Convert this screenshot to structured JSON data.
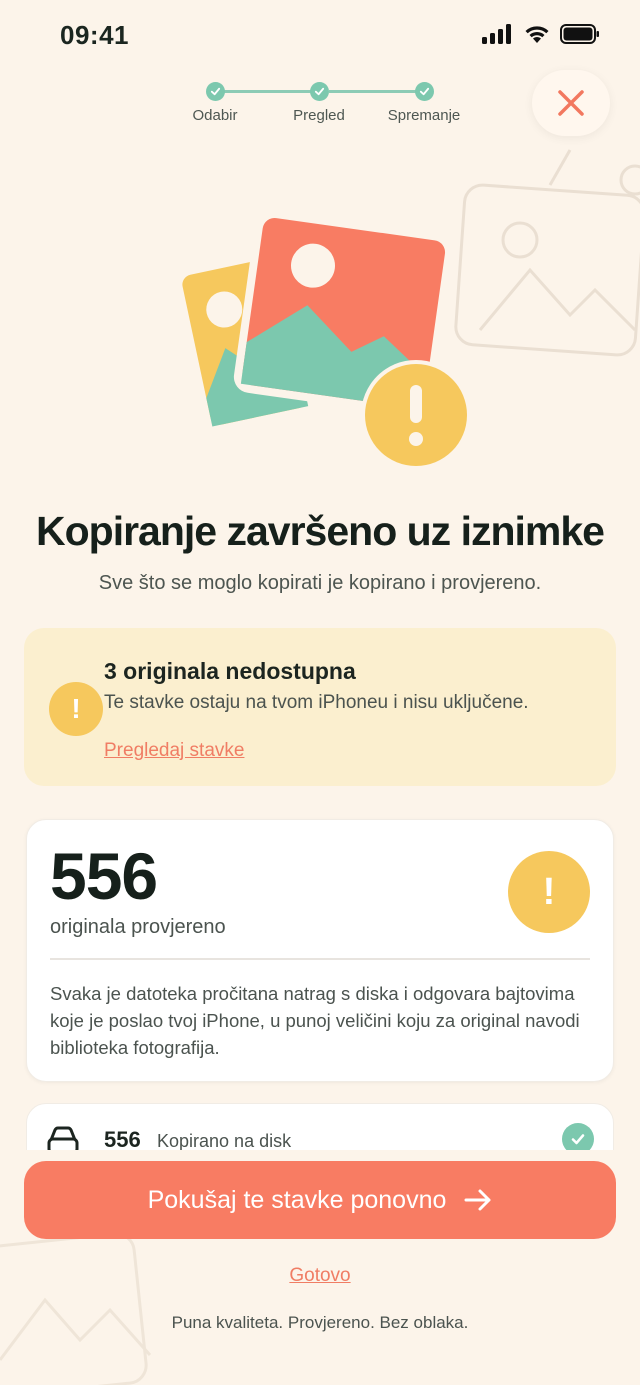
{
  "status_bar": {
    "time": "09:41"
  },
  "stepper": {
    "steps": [
      {
        "label": "Odabir"
      },
      {
        "label": "Pregled"
      },
      {
        "label": "Spremanje"
      }
    ]
  },
  "header": {
    "title": "Kopiranje završeno uz iznimke",
    "subtitle": "Sve što se moglo kopirati je kopirano i provjereno."
  },
  "warning": {
    "icon_text": "!",
    "title": "3 originala nedostupna",
    "description": "Te stavke ostaju na tvom iPhoneu i nisu uključene.",
    "link": "Pregledaj stavke"
  },
  "stats": {
    "number": "556",
    "label": "originala provjereno",
    "icon_text": "!",
    "description": "Svaka je datoteka pročitana natrag s diska i odgovara bajtovima koje je poslao tvoj iPhone, u punoj veličini koju za original navodi biblioteka fotografija."
  },
  "row": {
    "count": "556",
    "label": "Kopirano na disk",
    "icon": "drive-icon"
  },
  "actions": {
    "retry_label": "Pokušaj te stavke ponovno",
    "done_label": "Gotovo"
  },
  "footer": {
    "text": "Puna kvaliteta. Provjereno. Bez oblaka."
  },
  "colors": {
    "background": "#FCF4EA",
    "accent": "#F87C63",
    "warning": "#F6C85D",
    "success": "#7CC8AE",
    "warning_card": "#FBEFCF"
  }
}
